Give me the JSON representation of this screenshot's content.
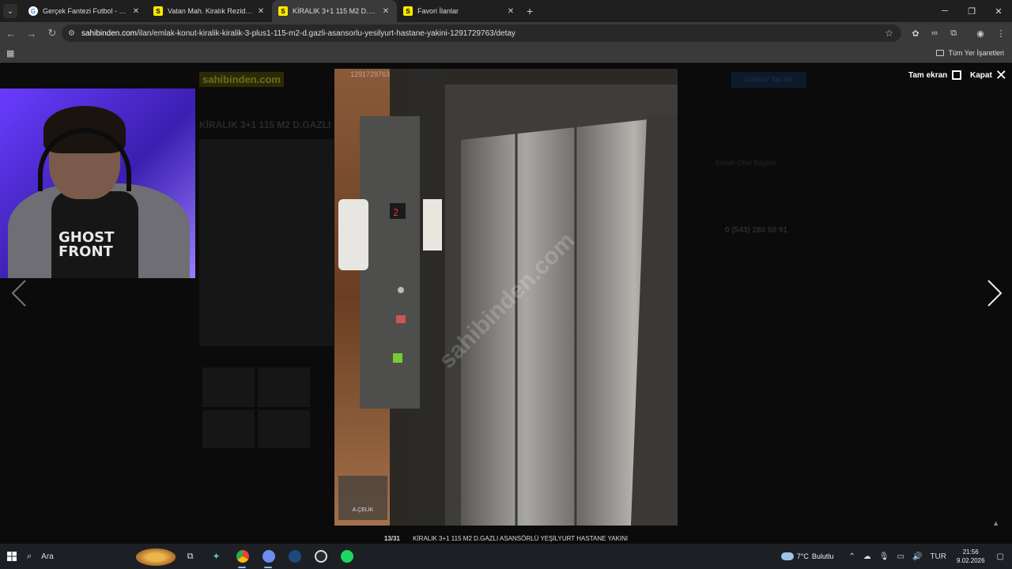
{
  "browser": {
    "tabs": [
      {
        "title": "Gerçek Fantezi Futbol - Sorare F",
        "favicon": "google-icon",
        "active": false
      },
      {
        "title": "Vatan Mah. Kiralık Rezidans, Villa",
        "favicon": "sahibinden-icon",
        "active": false
      },
      {
        "title": "KİRALIK 3+1 115 M2 D.GAZLI A",
        "favicon": "sahibinden-icon",
        "active": true
      },
      {
        "title": "Favori İlanlar",
        "favicon": "sahibinden-icon",
        "active": false
      }
    ],
    "url_domain": "sahibinden.com",
    "url_path": "/ilan/emlak-konut-kiralik-kiralik-3-plus1-115-m2-d.gazli-asansorlu-yesilyurt-hastane-yakini-1291729763/detay",
    "bookmarks_all": "Tüm Yer İşaretleri"
  },
  "background_site": {
    "logo": "sahibinden.com",
    "title": "KİRALIK 3+1 115 M2 D.GAZLI",
    "phone": "0 (543) 280 50 91",
    "cta": "Ücretsiz* İlan Ver",
    "contact": "Emlak Ofisi Bilgileri"
  },
  "webcam": {
    "shirt_text": "GHOST\nFRONT"
  },
  "viewer": {
    "fullscreen_label": "Tam ekran",
    "close_label": "Kapat",
    "photo_id": "1291729763",
    "watermark": "sahibinden.com",
    "logo_text": "A.ÇELİK",
    "counter": "13/31",
    "caption": "KİRALIK 3+1 115 M2 D.GAZLI ASANSÖRLÜ YEŞİLYURT HASTANE YAKINI"
  },
  "taskbar": {
    "search_label": "Ara",
    "weather_temp": "7°C",
    "weather_desc": "Bulutlu",
    "language": "TUR",
    "time": "21:56",
    "date": "9.02.2026"
  },
  "colors": {
    "accent": "#ffe800",
    "tab_bg": "#1f1f1f",
    "toolbar_bg": "#3a3a3a",
    "taskbar_bg": "#1c2024"
  }
}
